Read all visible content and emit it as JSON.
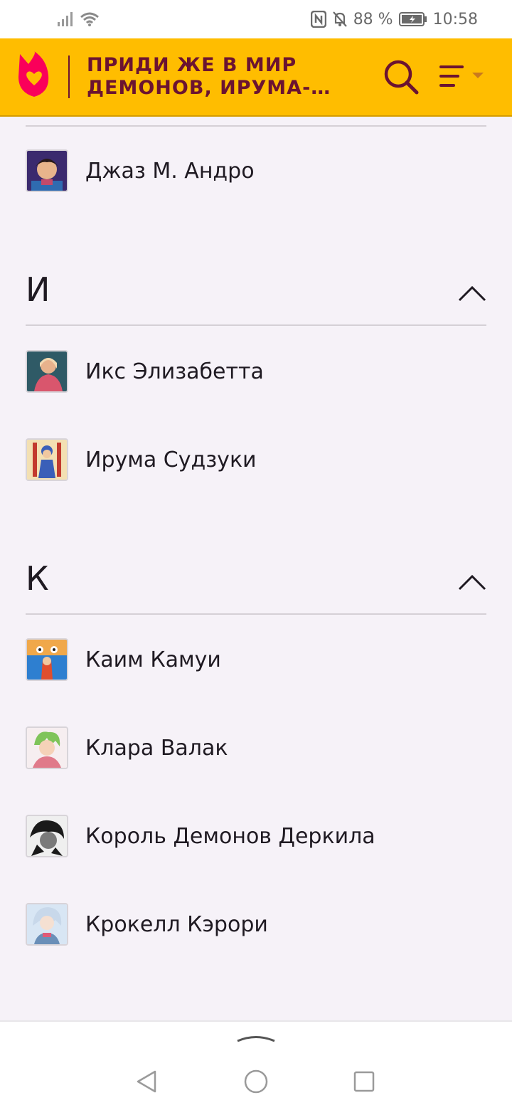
{
  "status_bar": {
    "battery": "88 %",
    "time": "10:58"
  },
  "header": {
    "title_line1": "ПРИДИ ЖЕ В МИР",
    "title_line2": "ДЕМОНОВ, ИРУМА-…",
    "search_icon": "search-icon",
    "menu_icon": "menu-icon",
    "brand_color": "#ffbd00",
    "title_color": "#6b1331"
  },
  "list": {
    "prev_item": {
      "label": "Джаз М. Андро",
      "thumb_colors": [
        "#3b2a6e",
        "#c24a6a",
        "#2f6bb0"
      ]
    },
    "sections": [
      {
        "letter": "И",
        "items": [
          {
            "label": "Икс Элизабетта",
            "thumb_colors": [
              "#2f5a66",
              "#e8b28c",
              "#d9566d"
            ]
          },
          {
            "label": "Ирума Судзуки",
            "thumb_colors": [
              "#f3e0b3",
              "#c23a2e",
              "#3a5fb8"
            ]
          }
        ]
      },
      {
        "letter": "К",
        "items": [
          {
            "label": "Каим Камуи",
            "thumb_colors": [
              "#2e7fd0",
              "#f0a84a",
              "#e04e2e"
            ]
          },
          {
            "label": "Клара Валак",
            "thumb_colors": [
              "#f6eef0",
              "#7fc45a",
              "#e07a8a"
            ]
          },
          {
            "label": "Король Демонов Деркила",
            "thumb_colors": [
              "#efefef",
              "#1a1a1a",
              "#7a7a7a"
            ]
          },
          {
            "label": "Крокелл Кэрори",
            "thumb_colors": [
              "#d8e6f4",
              "#6a8fb8",
              "#e05a78"
            ]
          }
        ]
      }
    ]
  }
}
